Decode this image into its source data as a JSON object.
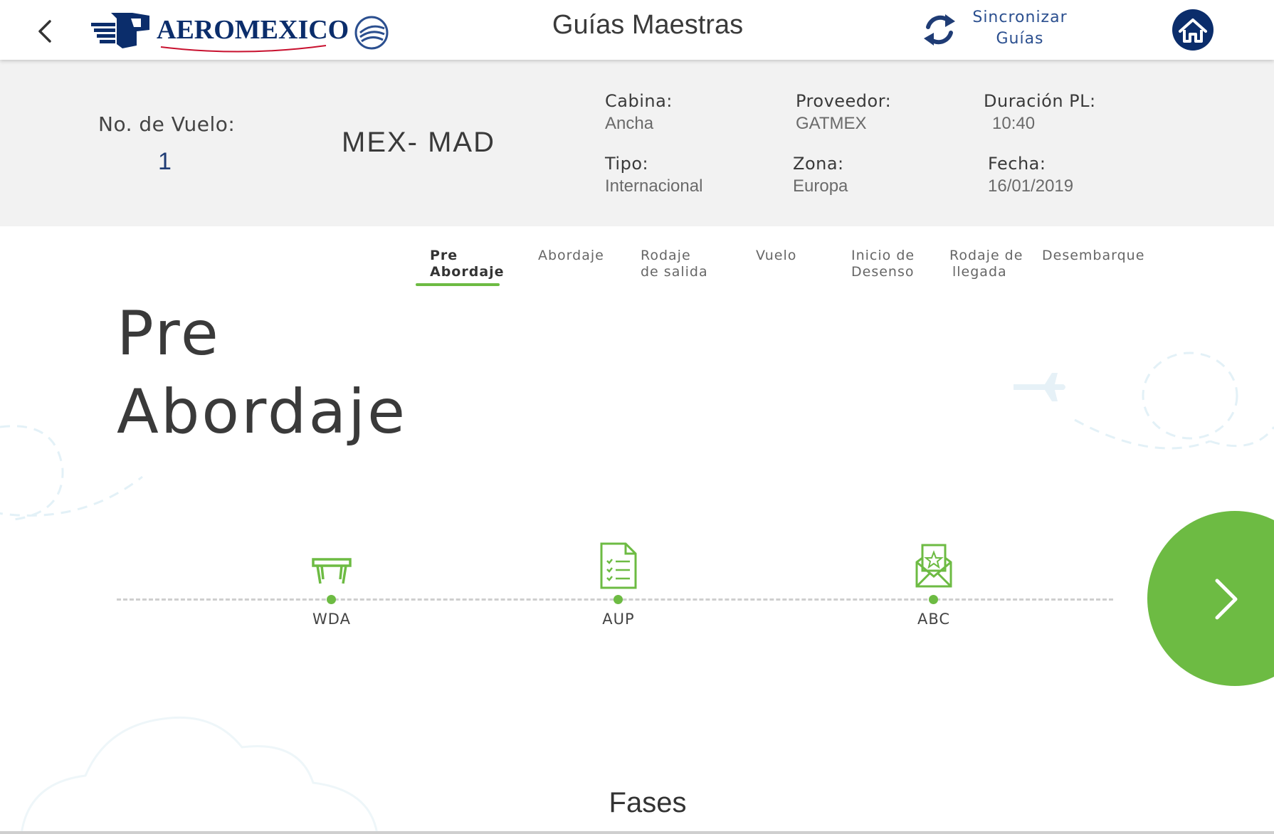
{
  "header": {
    "title": "Guías Maestras",
    "logo_text_main": "AEROMEXICO",
    "sync_label_line1": "Sincronizar",
    "sync_label_line2": "Guías",
    "back_icon": "chevron-left-icon",
    "sync_icon": "sync-icon",
    "home_icon": "home-icon"
  },
  "flight": {
    "number_label": "No. de Vuelo:",
    "number_value": "1",
    "route": "MEX- MAD",
    "cabina_label": "Cabina:",
    "cabina_value": "Ancha",
    "proveedor_label": "Proveedor:",
    "proveedor_value": "GATMEX",
    "duracion_label": "Duración PL:",
    "duracion_value": "10:40",
    "tipo_label": "Tipo:",
    "tipo_value": "Internacional",
    "zona_label": "Zona:",
    "zona_value": "Europa",
    "fecha_label": "Fecha:",
    "fecha_value": "16/01/2019"
  },
  "tabs": [
    {
      "line1": "Pre",
      "line2": "Abordaje",
      "active": true
    },
    {
      "line1": "Abordaje",
      "line2": ""
    },
    {
      "line1": "Rodaje",
      "line2": "de salida"
    },
    {
      "line1": "Vuelo",
      "line2": ""
    },
    {
      "line1": "Inicio de",
      "line2": "Desenso"
    },
    {
      "line1": "Rodaje de",
      "line2": "llegada"
    },
    {
      "line1": "Desembarque",
      "line2": ""
    }
  ],
  "phase": {
    "heading_line1": "Pre",
    "heading_line2": "Abordaje"
  },
  "timeline": [
    {
      "label": "WDA",
      "icon": "table-icon"
    },
    {
      "label": "AUP",
      "icon": "checklist-document-icon"
    },
    {
      "label": "ABC",
      "icon": "certificate-envelope-icon"
    }
  ],
  "footer": {
    "label": "Fases"
  },
  "colors": {
    "accent": "#6dbb43",
    "brand": "#0b2d6b",
    "sync": "#2b4f8f",
    "info_bg": "#f2f2f2"
  }
}
